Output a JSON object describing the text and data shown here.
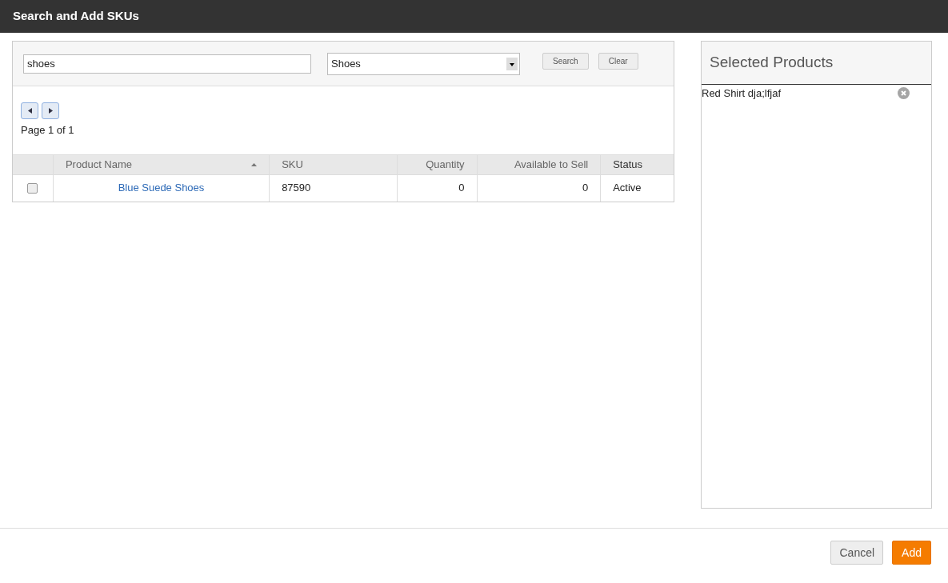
{
  "window": {
    "title": "Search and Add SKUs"
  },
  "search": {
    "query": "shoes",
    "category": "Shoes",
    "buttons": [
      "Search",
      "Clear"
    ]
  },
  "pager": {
    "text": "Page 1 of 1"
  },
  "table": {
    "columns": [
      {
        "sorted": false
      },
      {
        "label": "Product Name",
        "sorted": true
      },
      {
        "label": "SKU",
        "sorted": false
      },
      {
        "label": "Quantity",
        "sorted": false
      },
      {
        "label": "Available to Sell",
        "sorted": false
      },
      {
        "label": "Status",
        "sorted": false
      }
    ],
    "rows": [
      {
        "checked": false,
        "name": "Blue Suede Shoes",
        "sku": "87590",
        "quantity": "0",
        "available": "0",
        "status": "Active"
      }
    ]
  },
  "selected_products": {
    "title": "Selected Products",
    "items": [
      "Red Shirt dja;lfjaf"
    ]
  },
  "footer": {
    "cancel": "Cancel",
    "add": "Add"
  }
}
